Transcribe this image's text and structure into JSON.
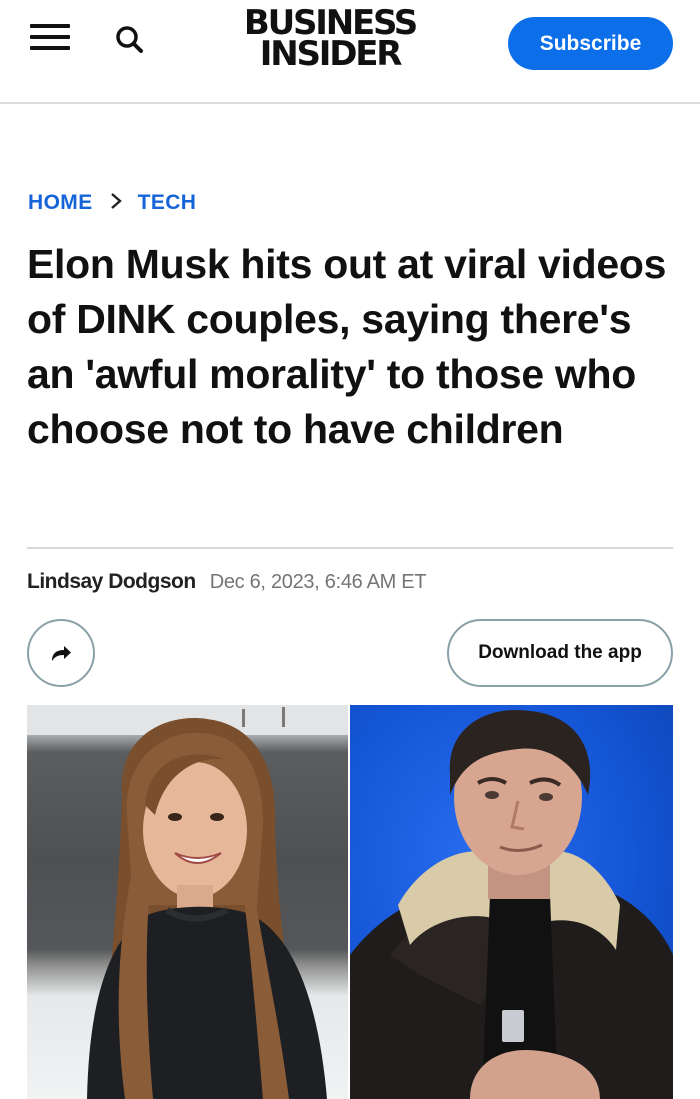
{
  "header": {
    "logo_line1": "BUSINESS",
    "logo_line2": "INSIDER",
    "subscribe_label": "Subscribe",
    "menu_icon": "hamburger-menu-icon",
    "search_icon": "search-icon",
    "accent_color": "#0c6ee8"
  },
  "breadcrumb": {
    "items": [
      "HOME",
      "TECH"
    ],
    "separator_icon": "chevron-right-icon"
  },
  "article": {
    "headline": "Elon Musk hits out at viral videos of DINK couples, saying there's an 'awful morality' to those who choose not to have children",
    "author": "Lindsay Dodgson",
    "date": "Dec 6, 2023, 6:46 AM ET"
  },
  "actions": {
    "share_icon": "share-arrow-icon",
    "download_label": "Download the app"
  },
  "hero": {
    "left_photo": "woman-smiling-photo",
    "right_photo": "elon-musk-photo"
  }
}
